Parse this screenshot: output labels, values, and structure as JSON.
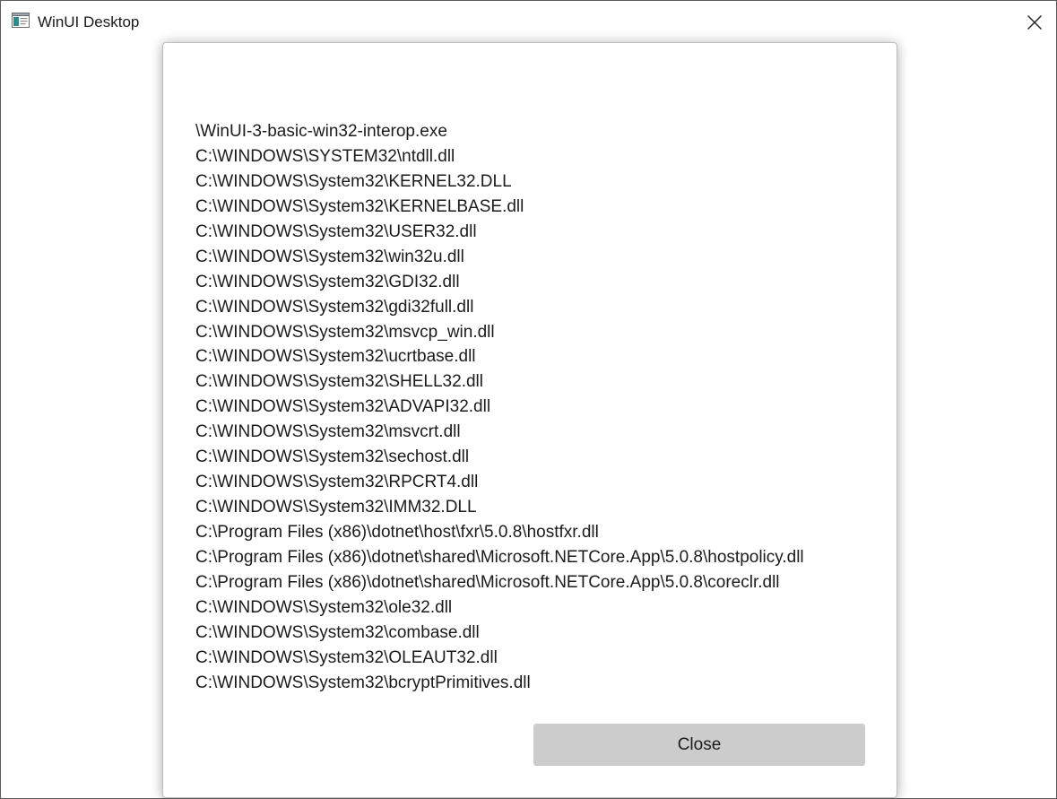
{
  "window": {
    "title": "WinUI Desktop",
    "app_icon": "app-window-icon",
    "close_icon": "close-icon"
  },
  "dialog": {
    "modules": [
      "\\WinUI-3-basic-win32-interop.exe",
      "C:\\WINDOWS\\SYSTEM32\\ntdll.dll",
      "C:\\WINDOWS\\System32\\KERNEL32.DLL",
      "C:\\WINDOWS\\System32\\KERNELBASE.dll",
      "C:\\WINDOWS\\System32\\USER32.dll",
      "C:\\WINDOWS\\System32\\win32u.dll",
      "C:\\WINDOWS\\System32\\GDI32.dll",
      "C:\\WINDOWS\\System32\\gdi32full.dll",
      "C:\\WINDOWS\\System32\\msvcp_win.dll",
      "C:\\WINDOWS\\System32\\ucrtbase.dll",
      "C:\\WINDOWS\\System32\\SHELL32.dll",
      "C:\\WINDOWS\\System32\\ADVAPI32.dll",
      "C:\\WINDOWS\\System32\\msvcrt.dll",
      "C:\\WINDOWS\\System32\\sechost.dll",
      "C:\\WINDOWS\\System32\\RPCRT4.dll",
      "C:\\WINDOWS\\System32\\IMM32.DLL",
      "C:\\Program Files (x86)\\dotnet\\host\\fxr\\5.0.8\\hostfxr.dll",
      "C:\\Program Files (x86)\\dotnet\\shared\\Microsoft.NETCore.App\\5.0.8\\hostpolicy.dll",
      "C:\\Program Files (x86)\\dotnet\\shared\\Microsoft.NETCore.App\\5.0.8\\coreclr.dll",
      "C:\\WINDOWS\\System32\\ole32.dll",
      "C:\\WINDOWS\\System32\\combase.dll",
      "C:\\WINDOWS\\System32\\OLEAUT32.dll",
      "C:\\WINDOWS\\System32\\bcryptPrimitives.dll"
    ],
    "close_label": "Close"
  }
}
